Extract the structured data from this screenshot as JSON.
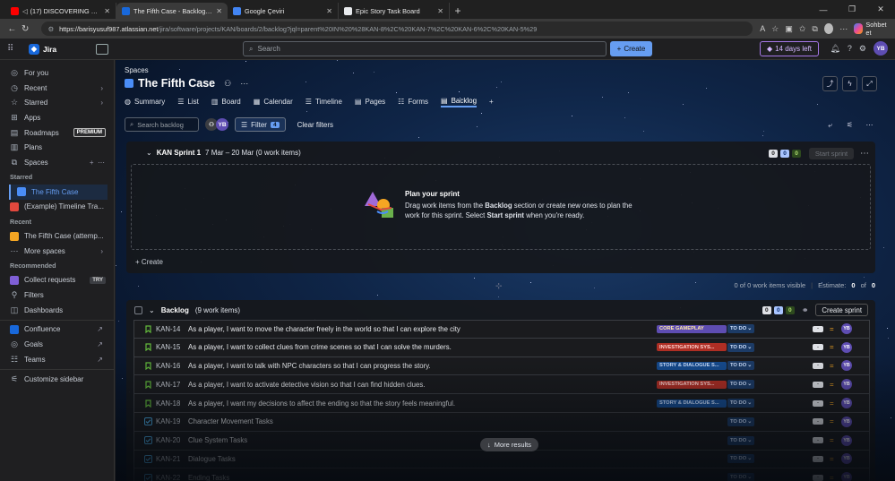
{
  "browser": {
    "tabs": [
      {
        "title": "(17) DISCOVERING TURKISH H",
        "fav": "#ff0000"
      },
      {
        "title": "The Fifth Case - Backlog - Jira",
        "fav": "#1868db"
      },
      {
        "title": "Google Çeviri",
        "fav": "#4285f4"
      },
      {
        "title": "Epic Story Task Board",
        "fav": "#e8eaed"
      }
    ],
    "url_host": "https://barisyusuf987.atlassian.net",
    "url_path": "/jira/software/projects/KAN/boards/2/backlog?jql=parent%20IN%20%28KAN-8%2C%20KAN-7%2C%20KAN-6%2C%20KAN-5%29",
    "copilot_label": "Sohbet et"
  },
  "topnav": {
    "app": "Jira",
    "search_placeholder": "Search",
    "create": "Create",
    "trial": "14 days left",
    "avatar": "YB"
  },
  "sidebar": {
    "for_you": "For you",
    "recent": "Recent",
    "starred": "Starred",
    "apps": "Apps",
    "roadmaps": "Roadmaps",
    "premium": "PREMIUM",
    "plans": "Plans",
    "spaces": "Spaces",
    "starred_head": "Starred",
    "fifth_case": "The Fifth Case",
    "example": "(Example) Timeline Tra...",
    "recent_head": "Recent",
    "fifth_attempt": "The Fifth Case (attemp...",
    "more_spaces": "More spaces",
    "recommended_head": "Recommended",
    "collect": "Collect requests",
    "try": "TRY",
    "filters": "Filters",
    "dashboards": "Dashboards",
    "confluence": "Confluence",
    "goals": "Goals",
    "teams": "Teams",
    "customize": "Customize sidebar"
  },
  "page": {
    "breadcrumb": "Spaces",
    "title": "The Fifth Case",
    "tabs": [
      "Summary",
      "List",
      "Board",
      "Calendar",
      "Timeline",
      "Pages",
      "Forms",
      "Backlog"
    ],
    "search_placeholder": "Search backlog",
    "filter": "Filter",
    "filter_count": "4",
    "clear": "Clear filters",
    "filter_avatar": "YB"
  },
  "sprint": {
    "name": "KAN Sprint 1",
    "dates": "7 Mar – 20 Mar (0 work items)",
    "counts": [
      "0",
      "0",
      "0"
    ],
    "start": "Start sprint",
    "plan_title": "Plan your sprint",
    "plan_desc_1": "Drag work items from the ",
    "plan_desc_b1": "Backlog",
    "plan_desc_2": " section or create new ones to plan the work for this sprint. Select ",
    "plan_desc_b2": "Start sprint",
    "plan_desc_3": " when you're ready.",
    "create": "+ Create"
  },
  "summary": {
    "visible": "0 of 0 work items visible",
    "estimate_label": "Estimate:",
    "estimate_a": "0",
    "estimate_of": "of",
    "estimate_b": "0"
  },
  "backlog": {
    "name": "Backlog",
    "count": "(9 work items)",
    "counts": [
      "0",
      "0",
      "0"
    ],
    "create_sprint": "Create sprint",
    "more": "More results",
    "items": [
      {
        "key": "KAN-14",
        "type": "story",
        "summary": "As a player, I want to move the character freely in the world so that I can explore the city",
        "epic": "CORE GAMEPLAY",
        "epic_bg": "#5e4db2",
        "epic_fg": "#ffe9a8",
        "status": "TO DO",
        "est": "-",
        "avatar": "YB"
      },
      {
        "key": "KAN-15",
        "type": "story",
        "summary": "As a player, I want to collect clues from crime scenes so that I can solve the murders.",
        "epic": "INVESTIGATION SYS...",
        "epic_bg": "#ae2e24",
        "epic_fg": "#ffd5d2",
        "status": "TO DO",
        "est": "-",
        "avatar": "YB"
      },
      {
        "key": "KAN-16",
        "type": "story",
        "summary": "As a player, I want to talk with NPC characters so that I can progress the story.",
        "epic": "STORY & DIALOGUE S...",
        "epic_bg": "#164b8f",
        "epic_fg": "#cce0ff",
        "status": "TO DO",
        "est": "-",
        "avatar": "YB"
      },
      {
        "key": "KAN-17",
        "type": "story",
        "summary": "As a player, I want to activate detective vision so that I can find hidden clues.",
        "epic": "INVESTIGATION SYS...",
        "epic_bg": "#ae2e24",
        "epic_fg": "#ffd5d2",
        "status": "TO DO",
        "est": "-",
        "avatar": "YB"
      },
      {
        "key": "KAN-18",
        "type": "story",
        "summary": "As a player, I want my decisions to affect the ending so that the story feels meaningful.",
        "epic": "STORY & DIALOGUE S...",
        "epic_bg": "#164b8f",
        "epic_fg": "#cce0ff",
        "status": "TO DO",
        "est": "-",
        "avatar": "YB"
      },
      {
        "key": "KAN-19",
        "type": "task",
        "summary": "Character Movement Tasks",
        "epic": "",
        "epic_bg": "",
        "epic_fg": "",
        "status": "TO DO",
        "est": "-",
        "avatar": "YB"
      },
      {
        "key": "KAN-20",
        "type": "task",
        "summary": "Clue System Tasks",
        "epic": "",
        "epic_bg": "",
        "epic_fg": "",
        "status": "TO DO",
        "est": "-",
        "avatar": "YB"
      },
      {
        "key": "KAN-21",
        "type": "task",
        "summary": "Dialogue Tasks",
        "epic": "",
        "epic_bg": "",
        "epic_fg": "",
        "status": "TO DO",
        "est": "-",
        "avatar": "YB"
      },
      {
        "key": "KAN-22",
        "type": "task",
        "summary": "Ending Tasks",
        "epic": "",
        "epic_bg": "",
        "epic_fg": "",
        "status": "TO DO",
        "est": "-",
        "avatar": "YB"
      }
    ]
  },
  "colors": {
    "accent": "#669df1",
    "story": "#63ba3c",
    "task": "#4bade8",
    "priority": "#f5a623"
  }
}
